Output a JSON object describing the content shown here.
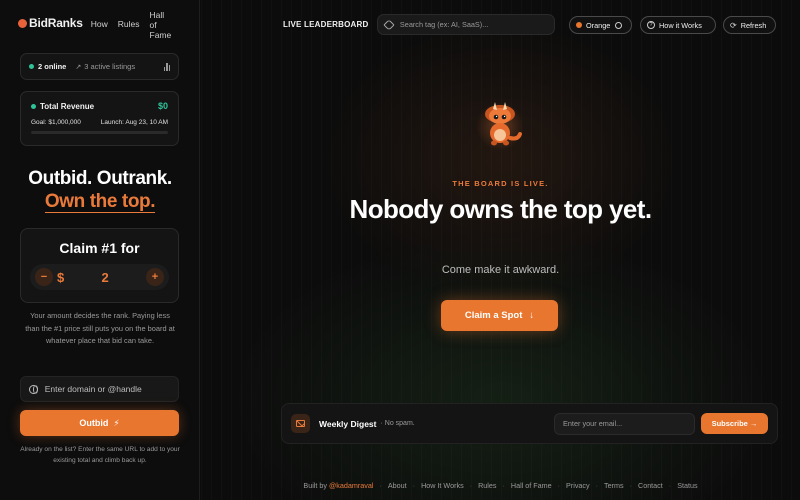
{
  "brand": {
    "name": "BidRanks"
  },
  "top_nav": [
    {
      "label": "How"
    },
    {
      "label": "Rules"
    },
    {
      "label": "Hall of Fame"
    }
  ],
  "stats": {
    "online": "2 online",
    "listings": "3 active listings"
  },
  "revenue": {
    "title": "Total Revenue",
    "amount": "$0",
    "goal": "Goal: $1,000,000",
    "launch": "Launch: Aug 23, 10 AM",
    "progress": 0
  },
  "tagline": {
    "line1": "Outbid. Outrank.",
    "line2": "Own the top."
  },
  "claim": {
    "title": "Claim #1 for",
    "currency": "$",
    "amount": "2",
    "minus": "−",
    "plus": "+"
  },
  "help_text": "Your amount decides the rank. Paying less than the #1 price still puts you on the board at whatever place that bid can take.",
  "domain_input": {
    "placeholder": "Enter domain or @handle"
  },
  "outbid": {
    "label": "Outbid",
    "bolt": "⚡"
  },
  "outbid_note": "Already on the list? Enter the same URL to add to your existing total and climb back up.",
  "header": {
    "title": "LIVE LEADERBOARD",
    "search_placeholder": "Search tag (ex: AI, SaaS)...",
    "theme_label": "Orange",
    "how_label": "How it Works",
    "refresh_label": "Refresh"
  },
  "hero": {
    "kicker": "THE BOARD IS LIVE.",
    "title": "Nobody owns the top yet.",
    "subtitle": "Come make it awkward.",
    "cta": "Claim a Spot",
    "cta_arrow": "↓"
  },
  "digest": {
    "title": "Weekly Digest",
    "note": "· No spam.",
    "email_placeholder": "Enter your email...",
    "subscribe": "Subscribe →"
  },
  "footer": {
    "built_by": "Built by",
    "author": "@kadamraval",
    "links": [
      "About",
      "How It Works",
      "Rules",
      "Hall of Fame",
      "Privacy",
      "Terms",
      "Contact",
      "Status"
    ]
  },
  "colors": {
    "accent": "#e8762f",
    "success": "#2fc39a",
    "background": "#0b0b0b"
  },
  "icons": [
    "globe-icon",
    "bolt-icon",
    "tag-icon",
    "palette-icon",
    "question-icon",
    "refresh-icon",
    "mail-icon",
    "trend-icon",
    "bar-chart-icon",
    "mascot-icon"
  ]
}
